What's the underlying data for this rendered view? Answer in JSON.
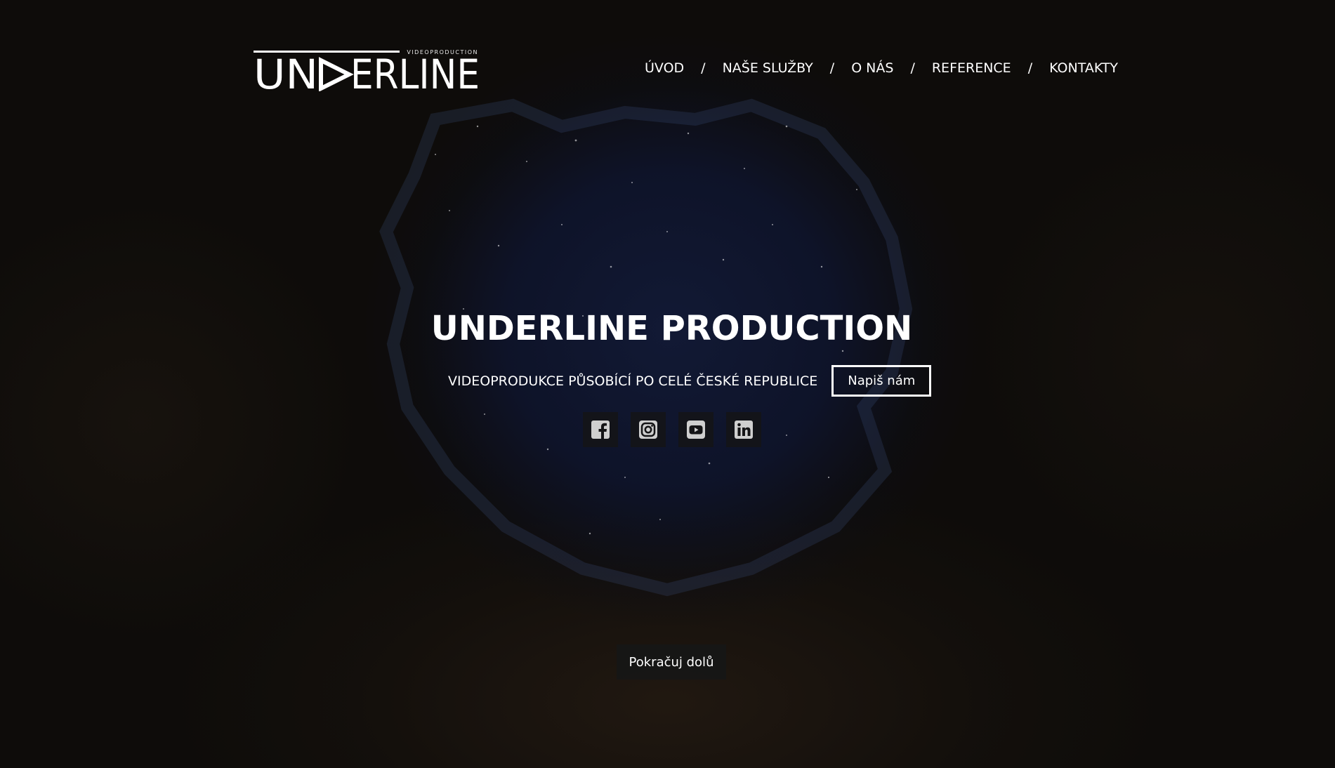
{
  "brand": {
    "logo_text": "UNDERLINE",
    "logo_tagline": "VIDEOPRODUCTION"
  },
  "nav": {
    "items": [
      {
        "label": "ÚVOD"
      },
      {
        "label": "NAŠE SLUŽBY"
      },
      {
        "label": "O NÁS"
      },
      {
        "label": "REFERENCE"
      },
      {
        "label": "KONTAKTY"
      }
    ],
    "separator": "/"
  },
  "hero": {
    "title": "UNDERLINE PRODUCTION",
    "subtitle": "VIDEOPRODUKCE PŮSOBÍCÍ PO CELÉ ČESKÉ REPUBLICE",
    "cta_label": "Napiš nám",
    "continue_label": "Pokračuj dolů"
  },
  "socials": [
    {
      "icon": "facebook-icon"
    },
    {
      "icon": "instagram-icon"
    },
    {
      "icon": "youtube-icon"
    },
    {
      "icon": "linkedin-icon"
    }
  ],
  "colors": {
    "text": "#ffffff",
    "background": "#0e0c0a",
    "sky": "#121a37",
    "icon": "#cfcfcf"
  }
}
